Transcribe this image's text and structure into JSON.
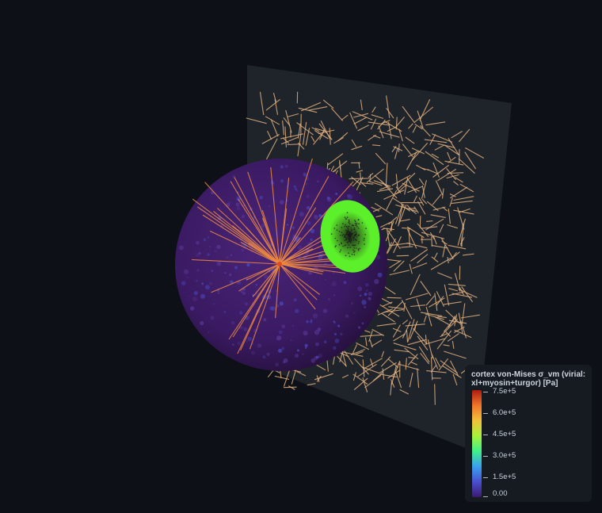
{
  "colorbar": {
    "title": "cortex von-Mises σ_vm (virial: xl+myosin+turgor) [Pa]",
    "ticks": [
      "7.5e+5",
      "6.0e+5",
      "4.5e+5",
      "3.0e+5",
      "1.5e+5",
      "0.00"
    ],
    "tick_values": [
      750000,
      600000,
      450000,
      300000,
      150000,
      0
    ],
    "range": [
      0,
      750000
    ],
    "colormap": [
      "#3b1a6e",
      "#4a4fd0",
      "#3aa0f0",
      "#3ef08a",
      "#a8f23a",
      "#f2c23a",
      "#f0762a",
      "#b01a10"
    ]
  },
  "scene": {
    "background_color": "#0d1117",
    "plane_color": "#1f242b",
    "filament_color": "#e0b080",
    "sphere_color": "#3a1a5e",
    "aster_color": "#f08a40",
    "contact_patch_color": "#5cf02a"
  }
}
